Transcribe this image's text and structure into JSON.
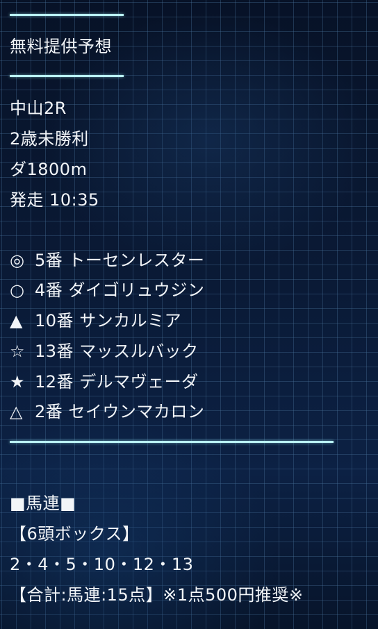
{
  "header": {
    "title": "無料提供予想"
  },
  "race": {
    "venue": "中山2R",
    "class": "2歳未勝利",
    "distance": "ダ1800m",
    "post_time": "発走 10:35"
  },
  "picks": [
    {
      "mark": "◎",
      "number": "5番",
      "horse": "トーセンレスター"
    },
    {
      "mark": "○",
      "number": "4番",
      "horse": "ダイゴリュウジン"
    },
    {
      "mark": "▲",
      "number": "10番",
      "horse": "サンカルミア"
    },
    {
      "mark": "☆",
      "number": "13番",
      "horse": "マッスルバック"
    },
    {
      "mark": "★",
      "number": "12番",
      "horse": "デルマヴェーダ"
    },
    {
      "mark": "△",
      "number": "2番",
      "horse": "セイウンマカロン"
    }
  ],
  "bet": {
    "type_label": "■馬連■",
    "box_label": "【6頭ボックス】",
    "numbers": "2・4・5・10・12・13",
    "total": "【合計:馬連:15点】※1点500円推奨※"
  }
}
